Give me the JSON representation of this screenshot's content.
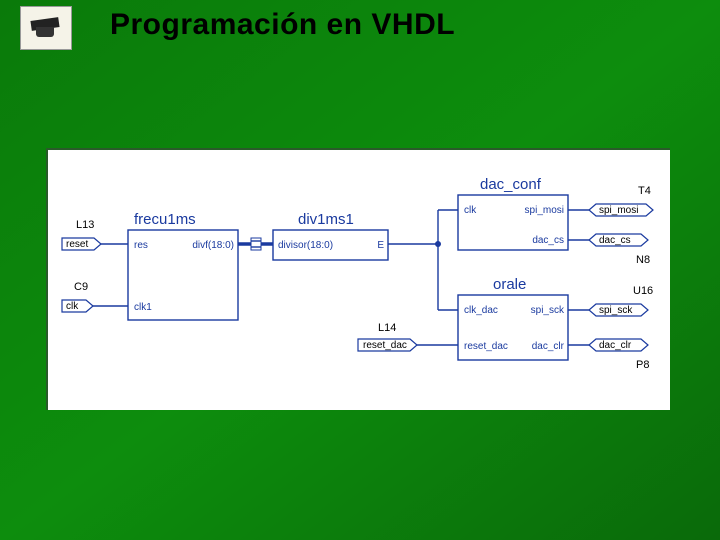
{
  "title": "Programación en VHDL",
  "blocks": {
    "frecu1ms": {
      "name": "frecu1ms",
      "ports": {
        "res": "res",
        "clk1": "clk1",
        "divf": "divf(18:0)"
      }
    },
    "div1ms1": {
      "name": "div1ms1",
      "ports": {
        "divisor": "divisor(18:0)",
        "E": "E"
      }
    },
    "dac_conf": {
      "name": "dac_conf",
      "ports": {
        "clk": "clk",
        "spi_mosi": "spi_mosi",
        "dac_cs": "dac_cs"
      }
    },
    "orale": {
      "name": "orale",
      "ports": {
        "clk_dac": "clk_dac",
        "reset_dac": "reset_dac",
        "spi_sck": "spi_sck",
        "dac_clr": "dac_clr"
      }
    }
  },
  "ext": {
    "reset": {
      "label": "reset",
      "loc": "L13"
    },
    "clk": {
      "label": "clk",
      "loc": "C9"
    },
    "reset_dac": {
      "label": "reset_dac",
      "loc": "L14"
    },
    "spi_mosi": {
      "label": "spi_mosi",
      "loc": "T4"
    },
    "dac_cs": {
      "label": "dac_cs",
      "loc": "N8"
    },
    "spi_sck": {
      "label": "spi_sck",
      "loc": "U16"
    },
    "dac_clr": {
      "label": "dac_clr",
      "loc": "P8"
    }
  }
}
